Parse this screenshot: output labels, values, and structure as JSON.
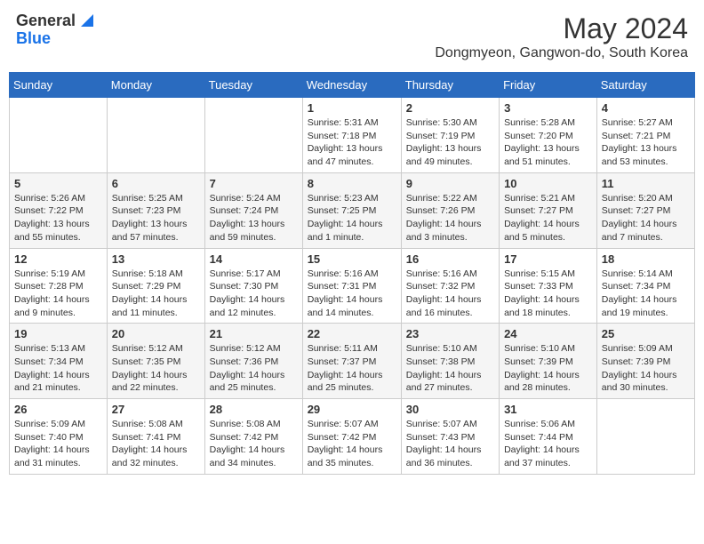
{
  "header": {
    "logo_general": "General",
    "logo_blue": "Blue",
    "month_title": "May 2024",
    "location": "Dongmyeon, Gangwon-do, South Korea"
  },
  "days_of_week": [
    "Sunday",
    "Monday",
    "Tuesday",
    "Wednesday",
    "Thursday",
    "Friday",
    "Saturday"
  ],
  "weeks": [
    [
      {
        "day": "",
        "info": ""
      },
      {
        "day": "",
        "info": ""
      },
      {
        "day": "",
        "info": ""
      },
      {
        "day": "1",
        "info": "Sunrise: 5:31 AM\nSunset: 7:18 PM\nDaylight: 13 hours\nand 47 minutes."
      },
      {
        "day": "2",
        "info": "Sunrise: 5:30 AM\nSunset: 7:19 PM\nDaylight: 13 hours\nand 49 minutes."
      },
      {
        "day": "3",
        "info": "Sunrise: 5:28 AM\nSunset: 7:20 PM\nDaylight: 13 hours\nand 51 minutes."
      },
      {
        "day": "4",
        "info": "Sunrise: 5:27 AM\nSunset: 7:21 PM\nDaylight: 13 hours\nand 53 minutes."
      }
    ],
    [
      {
        "day": "5",
        "info": "Sunrise: 5:26 AM\nSunset: 7:22 PM\nDaylight: 13 hours\nand 55 minutes."
      },
      {
        "day": "6",
        "info": "Sunrise: 5:25 AM\nSunset: 7:23 PM\nDaylight: 13 hours\nand 57 minutes."
      },
      {
        "day": "7",
        "info": "Sunrise: 5:24 AM\nSunset: 7:24 PM\nDaylight: 13 hours\nand 59 minutes."
      },
      {
        "day": "8",
        "info": "Sunrise: 5:23 AM\nSunset: 7:25 PM\nDaylight: 14 hours\nand 1 minute."
      },
      {
        "day": "9",
        "info": "Sunrise: 5:22 AM\nSunset: 7:26 PM\nDaylight: 14 hours\nand 3 minutes."
      },
      {
        "day": "10",
        "info": "Sunrise: 5:21 AM\nSunset: 7:27 PM\nDaylight: 14 hours\nand 5 minutes."
      },
      {
        "day": "11",
        "info": "Sunrise: 5:20 AM\nSunset: 7:27 PM\nDaylight: 14 hours\nand 7 minutes."
      }
    ],
    [
      {
        "day": "12",
        "info": "Sunrise: 5:19 AM\nSunset: 7:28 PM\nDaylight: 14 hours\nand 9 minutes."
      },
      {
        "day": "13",
        "info": "Sunrise: 5:18 AM\nSunset: 7:29 PM\nDaylight: 14 hours\nand 11 minutes."
      },
      {
        "day": "14",
        "info": "Sunrise: 5:17 AM\nSunset: 7:30 PM\nDaylight: 14 hours\nand 12 minutes."
      },
      {
        "day": "15",
        "info": "Sunrise: 5:16 AM\nSunset: 7:31 PM\nDaylight: 14 hours\nand 14 minutes."
      },
      {
        "day": "16",
        "info": "Sunrise: 5:16 AM\nSunset: 7:32 PM\nDaylight: 14 hours\nand 16 minutes."
      },
      {
        "day": "17",
        "info": "Sunrise: 5:15 AM\nSunset: 7:33 PM\nDaylight: 14 hours\nand 18 minutes."
      },
      {
        "day": "18",
        "info": "Sunrise: 5:14 AM\nSunset: 7:34 PM\nDaylight: 14 hours\nand 19 minutes."
      }
    ],
    [
      {
        "day": "19",
        "info": "Sunrise: 5:13 AM\nSunset: 7:34 PM\nDaylight: 14 hours\nand 21 minutes."
      },
      {
        "day": "20",
        "info": "Sunrise: 5:12 AM\nSunset: 7:35 PM\nDaylight: 14 hours\nand 22 minutes."
      },
      {
        "day": "21",
        "info": "Sunrise: 5:12 AM\nSunset: 7:36 PM\nDaylight: 14 hours\nand 25 minutes."
      },
      {
        "day": "22",
        "info": "Sunrise: 5:11 AM\nSunset: 7:37 PM\nDaylight: 14 hours\nand 25 minutes."
      },
      {
        "day": "23",
        "info": "Sunrise: 5:10 AM\nSunset: 7:38 PM\nDaylight: 14 hours\nand 27 minutes."
      },
      {
        "day": "24",
        "info": "Sunrise: 5:10 AM\nSunset: 7:39 PM\nDaylight: 14 hours\nand 28 minutes."
      },
      {
        "day": "25",
        "info": "Sunrise: 5:09 AM\nSunset: 7:39 PM\nDaylight: 14 hours\nand 30 minutes."
      }
    ],
    [
      {
        "day": "26",
        "info": "Sunrise: 5:09 AM\nSunset: 7:40 PM\nDaylight: 14 hours\nand 31 minutes."
      },
      {
        "day": "27",
        "info": "Sunrise: 5:08 AM\nSunset: 7:41 PM\nDaylight: 14 hours\nand 32 minutes."
      },
      {
        "day": "28",
        "info": "Sunrise: 5:08 AM\nSunset: 7:42 PM\nDaylight: 14 hours\nand 34 minutes."
      },
      {
        "day": "29",
        "info": "Sunrise: 5:07 AM\nSunset: 7:42 PM\nDaylight: 14 hours\nand 35 minutes."
      },
      {
        "day": "30",
        "info": "Sunrise: 5:07 AM\nSunset: 7:43 PM\nDaylight: 14 hours\nand 36 minutes."
      },
      {
        "day": "31",
        "info": "Sunrise: 5:06 AM\nSunset: 7:44 PM\nDaylight: 14 hours\nand 37 minutes."
      },
      {
        "day": "",
        "info": ""
      }
    ]
  ]
}
